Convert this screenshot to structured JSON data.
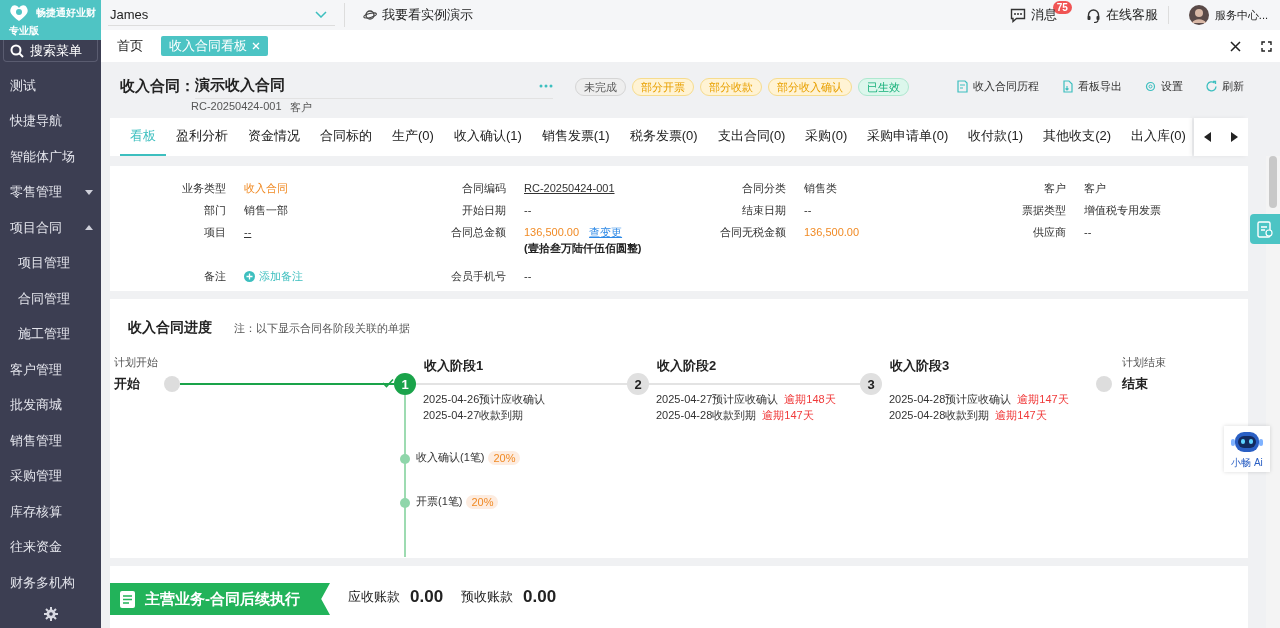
{
  "brand": {
    "name": "畅捷通好业财",
    "edition": "专业版"
  },
  "topbar": {
    "account": "James",
    "demo": "我要看实例演示",
    "messages": {
      "label": "消息",
      "badge": "75"
    },
    "support": "在线客服",
    "user": "服务中心..."
  },
  "sidebar": {
    "search": "搜索菜单",
    "items": [
      {
        "label": "测试",
        "kind": "link"
      },
      {
        "label": "快捷导航",
        "kind": "link"
      },
      {
        "label": "智能体广场",
        "kind": "link"
      },
      {
        "label": "零售管理",
        "kind": "group",
        "expanded": false
      },
      {
        "label": "项目合同",
        "kind": "group",
        "expanded": true,
        "children": [
          {
            "label": "项目管理"
          },
          {
            "label": "合同管理"
          },
          {
            "label": "施工管理"
          }
        ]
      },
      {
        "label": "客户管理",
        "kind": "link"
      },
      {
        "label": "批发商城",
        "kind": "link"
      },
      {
        "label": "销售管理",
        "kind": "link"
      },
      {
        "label": "采购管理",
        "kind": "link"
      },
      {
        "label": "库存核算",
        "kind": "link"
      },
      {
        "label": "往来资金",
        "kind": "link"
      },
      {
        "label": "财务多机构",
        "kind": "link"
      }
    ]
  },
  "page_tabs": [
    {
      "label": "首页",
      "selected": false,
      "closable": false
    },
    {
      "label": "收入合同看板",
      "selected": true,
      "closable": true
    }
  ],
  "header": {
    "prefix": "收入合同：",
    "title": "演示收入合同",
    "code": "RC-20250424-001",
    "customer": "客户",
    "statuses": [
      {
        "label": "未完成",
        "kind": "neutral"
      },
      {
        "label": "部分开票",
        "kind": "warning"
      },
      {
        "label": "部分收款",
        "kind": "warning"
      },
      {
        "label": "部分收入确认",
        "kind": "warning"
      },
      {
        "label": "已生效",
        "kind": "success"
      }
    ],
    "actions": [
      {
        "label": "收入合同历程",
        "kind": "history"
      },
      {
        "label": "看板导出",
        "kind": "export"
      },
      {
        "label": "设置",
        "kind": "settings"
      },
      {
        "label": "刷新",
        "kind": "refresh"
      }
    ]
  },
  "tabs": [
    {
      "label": "看板",
      "selected": true
    },
    {
      "label": "盈利分析",
      "selected": false
    },
    {
      "label": "资金情况",
      "selected": false
    },
    {
      "label": "合同标的",
      "selected": false
    },
    {
      "label": "生产(0)",
      "selected": false
    },
    {
      "label": "收入确认(1)",
      "selected": false
    },
    {
      "label": "销售发票(1)",
      "selected": false
    },
    {
      "label": "税务发票(0)",
      "selected": false
    },
    {
      "label": "支出合同(0)",
      "selected": false
    },
    {
      "label": "采购(0)",
      "selected": false
    },
    {
      "label": "采购申请单(0)",
      "selected": false
    },
    {
      "label": "收付款(1)",
      "selected": false
    },
    {
      "label": "其他收支(2)",
      "selected": false
    },
    {
      "label": "出入库(0)",
      "selected": false
    }
  ],
  "fields": [
    {
      "label": "业务类型",
      "value": "收入合同",
      "kind": "accent"
    },
    {
      "label": "合同编码",
      "value": "RC-20250424-001",
      "kind": "link"
    },
    {
      "label": "合同分类",
      "value": "销售类",
      "kind": "text"
    },
    {
      "label": "客户",
      "value": "客户",
      "kind": "text"
    },
    {
      "label": "部门",
      "value": "销售一部",
      "kind": "text"
    },
    {
      "label": "开始日期",
      "value": "--",
      "kind": "text"
    },
    {
      "label": "结束日期",
      "value": "--",
      "kind": "text"
    },
    {
      "label": "票据类型",
      "value": "增值税专用发票",
      "kind": "text"
    },
    {
      "label": "项目",
      "value": "--",
      "kind": "link"
    },
    {
      "label": "合同总金额",
      "value": "136,500.00",
      "kind": "amount",
      "action": "查变更",
      "note": "(壹拾叁万陆仟伍佰圆整)"
    },
    {
      "label": "合同无税金额",
      "value": "136,500.00",
      "kind": "accent"
    },
    {
      "label": "供应商",
      "value": "--",
      "kind": "text"
    },
    {
      "label": "备注",
      "value": "添加备注",
      "kind": "add"
    },
    {
      "label": "会员手机号",
      "value": "--",
      "kind": "text"
    }
  ],
  "progress": {
    "title": "收入合同进度",
    "note": "注：以下显示合同各阶段关联的单据",
    "start": {
      "caption": "计划开始",
      "label": "开始"
    },
    "stages": [
      {
        "number": "1",
        "title": "收入阶段1",
        "done": true,
        "lines": [
          {
            "text": "2025-04-26预计应收确认"
          },
          {
            "text": "2025-04-27收款到期"
          }
        ],
        "docs": [
          {
            "label": "收入确认(1笔)",
            "percent": "20%"
          },
          {
            "label": "开票(1笔)",
            "percent": "20%"
          }
        ]
      },
      {
        "number": "2",
        "title": "收入阶段2",
        "done": false,
        "lines": [
          {
            "text": "2025-04-27预计应收确认",
            "overdue": "逾期148天"
          },
          {
            "text": "2025-04-28收款到期",
            "overdue": "逾期147天"
          }
        ]
      },
      {
        "number": "3",
        "title": "收入阶段3",
        "done": false,
        "lines": [
          {
            "text": "2025-04-28预计应收确认",
            "overdue": "逾期147天"
          },
          {
            "text": "2025-04-28收款到期",
            "overdue": "逾期147天"
          }
        ]
      }
    ],
    "end": {
      "caption": "计划结束",
      "label": "结束"
    }
  },
  "execution": {
    "title": "主营业务-合同后续执行",
    "metrics": [
      {
        "label": "应收账款",
        "value": "0.00"
      },
      {
        "label": "预收账款",
        "value": "0.00"
      }
    ]
  },
  "assistant": {
    "label": "小畅 Ai"
  }
}
